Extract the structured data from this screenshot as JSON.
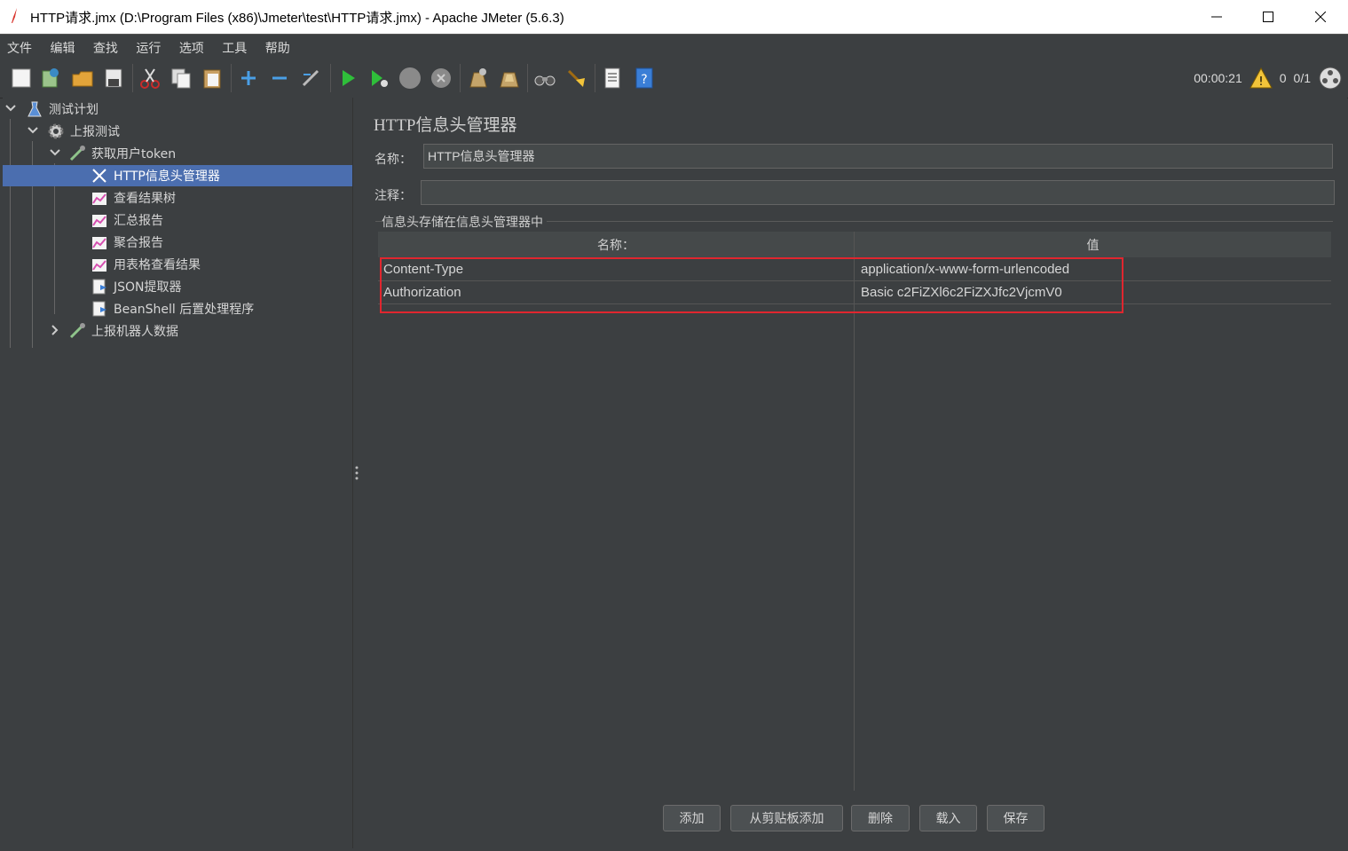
{
  "window": {
    "title": "HTTP请求.jmx (D:\\Program Files (x86)\\Jmeter\\test\\HTTP请求.jmx) - Apache JMeter (5.6.3)"
  },
  "menu": [
    "文件",
    "编辑",
    "查找",
    "运行",
    "选项",
    "工具",
    "帮助"
  ],
  "toolbar": {
    "timer": "00:00:21",
    "warnings": "0",
    "threads": "0/1",
    "icons": [
      "new-icon",
      "templates-icon",
      "open-icon",
      "save-icon",
      "cut-icon",
      "copy-icon",
      "paste-icon",
      "expand-icon",
      "collapse-icon",
      "toggle-icon",
      "start-icon",
      "start-no-pause-icon",
      "stop-icon",
      "shutdown-icon",
      "clear-icon",
      "clear-all-icon",
      "search-icon",
      "reset-search-icon",
      "function-helper-icon",
      "help-icon"
    ]
  },
  "tree": {
    "items": [
      {
        "label": "测试计划"
      },
      {
        "label": "上报测试"
      },
      {
        "label": "获取用户token"
      },
      {
        "label": "HTTP信息头管理器"
      },
      {
        "label": "查看结果树"
      },
      {
        "label": "汇总报告"
      },
      {
        "label": "聚合报告"
      },
      {
        "label": "用表格查看结果"
      },
      {
        "label": "JSON提取器"
      },
      {
        "label": "BeanShell 后置处理程序"
      },
      {
        "label": "上报机器人数据"
      }
    ]
  },
  "panel": {
    "title": "HTTP信息头管理器",
    "name_label": "名称：",
    "name_value": "HTTP信息头管理器",
    "comment_label": "注释：",
    "comment_value": "",
    "group_title": "信息头存储在信息头管理器中",
    "table": {
      "headers": [
        "名称：",
        "值"
      ],
      "rows": [
        {
          "name": "Content-Type",
          "value": "application/x-www-form-urlencoded"
        },
        {
          "name": "Authorization",
          "value": "Basic c2FiZXl6c2FiZXJfc2VjcmV0"
        }
      ]
    },
    "buttons": [
      "添加",
      "从剪贴板添加",
      "删除",
      "载入",
      "保存"
    ]
  },
  "colors": {
    "background": "#3c3f41",
    "selection": "#4b6eaf",
    "highlight_box": "#e0262f"
  }
}
